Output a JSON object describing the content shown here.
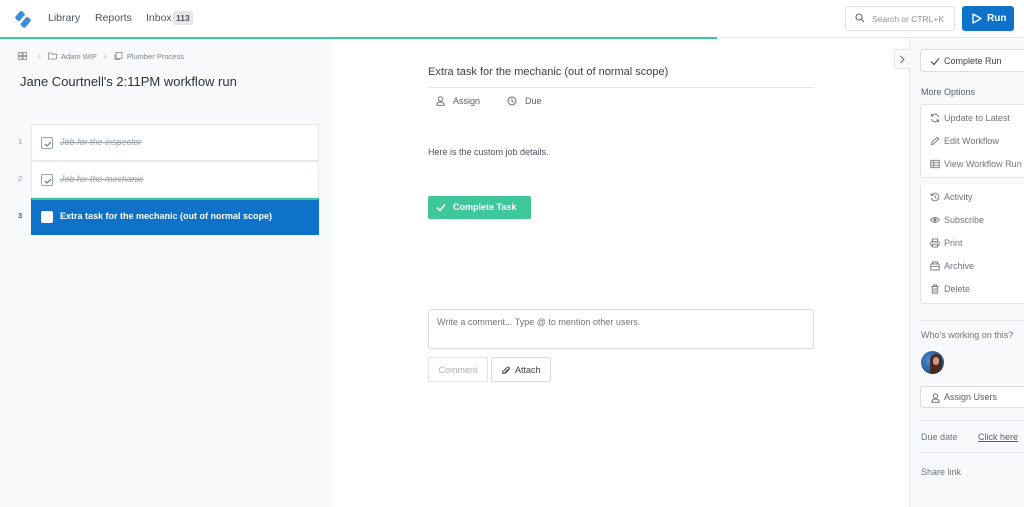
{
  "nav": {
    "logo": "process-street-logo",
    "links": [
      "Library",
      "Reports",
      "Inbox"
    ],
    "inbox_count": "113",
    "search_placeholder": "Search or CTRL+K",
    "run_label": "Run",
    "run_progress_percent": 70
  },
  "breadcrumb": {
    "items": [
      "Adam WIP",
      "Plumber Process"
    ]
  },
  "run_title": "Jane Courtnell's 2:11PM workflow run",
  "tasks": [
    {
      "number": "1",
      "label": "Job for the inspector",
      "completed": true,
      "active": false
    },
    {
      "number": "2",
      "label": "Job for the mechanic",
      "completed": true,
      "active": false
    },
    {
      "number": "3",
      "label": "Extra task for the mechanic (out of normal scope)",
      "completed": false,
      "active": true
    }
  ],
  "task_detail": {
    "title": "Extra task for the mechanic (out of normal scope)",
    "assign_label": "Assign",
    "due_label": "Due",
    "body": "Here is the custom job details.",
    "complete_label": "Complete Task"
  },
  "comment": {
    "placeholder": "Write a comment... Type @ to mention other users.",
    "comment_label": "Comment",
    "attach_label": "Attach"
  },
  "right_panel": {
    "complete_run_label": "Complete Run",
    "more_options_label": "More Options",
    "options_group1": [
      "Update to Latest",
      "Edit Workflow",
      "View Workflow Run"
    ],
    "options_group2": [
      "Activity",
      "Subscribe",
      "Print",
      "Archive",
      "Delete"
    ],
    "who_working_label": "Who's working on this?",
    "assign_users_label": "Assign Users",
    "due_date_label": "Due date",
    "due_date_link": "Click here",
    "share_link_label": "Share link"
  },
  "colors": {
    "primary": "#0e72c9",
    "success": "#3ec79b",
    "progress": "#39c69a"
  }
}
